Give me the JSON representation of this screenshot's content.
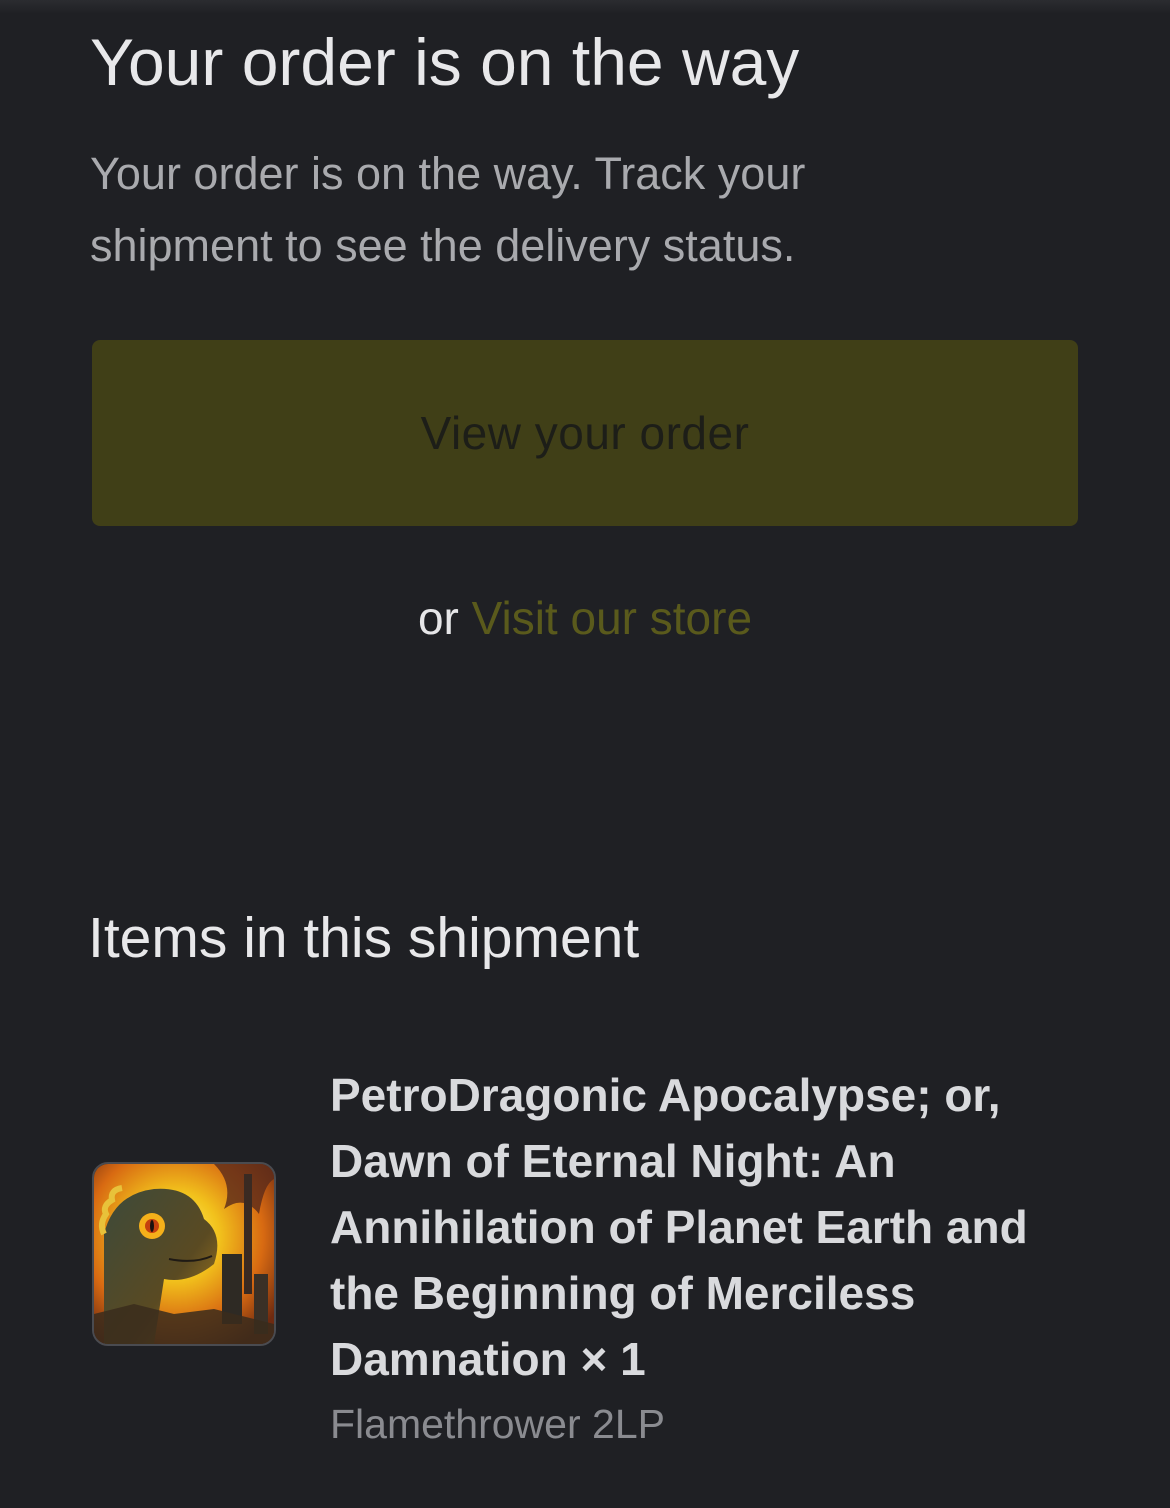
{
  "header": {
    "title": "Your order is on the way",
    "subtitle": "Your order is on the way. Track your shipment to see the delivery status."
  },
  "actions": {
    "view_order_label": "View your order",
    "or_text": "or",
    "visit_store_label": "Visit our store"
  },
  "shipment": {
    "section_title": "Items in this shipment",
    "items": [
      {
        "title": "PetroDragonic Apocalypse; or, Dawn of Eternal Night: An Annihilation of Planet Earth and the Beginning of Merciless Damnation × 1",
        "variant": "Flamethrower 2LP"
      }
    ]
  },
  "colors": {
    "background": "#1f2024",
    "button": "#403f17",
    "link": "#5a5a1c"
  }
}
